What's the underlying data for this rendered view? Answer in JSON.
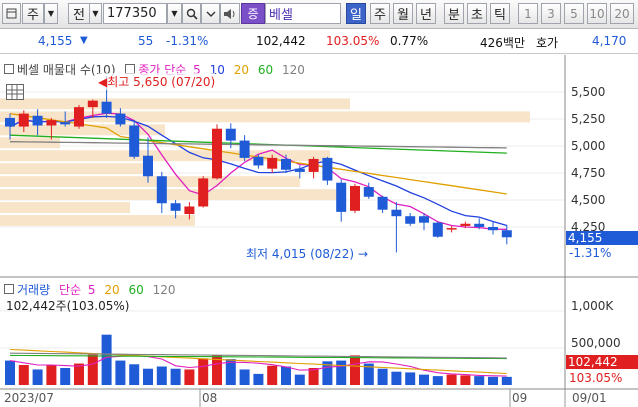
{
  "toolbar": {
    "market": "주",
    "mode": "전",
    "code": "177350",
    "stock_name_prefix": "증",
    "stock_name": "베셀",
    "periods": [
      "일",
      "주",
      "월",
      "년",
      "분",
      "초",
      "틱"
    ],
    "selected_period": "일",
    "intervals": [
      "1",
      "3",
      "5",
      "10",
      "20"
    ]
  },
  "info": {
    "price": "4,155",
    "change": "55",
    "change_pct": "-1.31%",
    "volume": "102,442",
    "volume_ratio": "103.05%",
    "turnover": "0.77%",
    "amount": "426백만",
    "bid_label": "호가",
    "bid_price": "4,170"
  },
  "price_panel": {
    "legend_name": "베셀 매물대 수(10)",
    "ma_label": "종가 단순",
    "ma_periods": [
      "5",
      "10",
      "20",
      "60",
      "120"
    ],
    "high_annotation": "최고 5,650 (07/20)",
    "low_annotation": "최저 4,015 (08/22)",
    "yaxis_ticks": [
      "5,500",
      "5,250",
      "5,000",
      "4,750",
      "4,500",
      "4,250"
    ],
    "current_price_tag": "4,155",
    "current_change_tag": "-1.31%"
  },
  "volume_panel": {
    "legend_name": "거래량",
    "ma_label": "단순",
    "ma_periods": [
      "5",
      "20",
      "60",
      "120"
    ],
    "current_label": "102,442주(103.05%)",
    "yaxis_ticks": [
      "1,000K",
      "500,000"
    ],
    "current_tag": "102,442",
    "current_pct_tag": "103.05%"
  },
  "xaxis": {
    "labels": [
      "2023/07",
      "08",
      "09"
    ],
    "right_date": "09/01"
  },
  "colors": {
    "up": "#e02020",
    "down": "#1f5bd6",
    "ma5": "#e020c0",
    "ma10": "#2040e0",
    "ma20": "#e0a000",
    "ma60": "#20b020",
    "ma120": "#808080",
    "volume_profile": "#f7dfc0"
  },
  "chart_data": {
    "type": "candlestick",
    "candles": [
      {
        "o": 5260,
        "h": 5300,
        "l": 5060,
        "c": 5180
      },
      {
        "o": 5180,
        "h": 5330,
        "l": 5130,
        "c": 5300
      },
      {
        "o": 5280,
        "h": 5340,
        "l": 5100,
        "c": 5190
      },
      {
        "o": 5190,
        "h": 5260,
        "l": 5060,
        "c": 5240
      },
      {
        "o": 5220,
        "h": 5320,
        "l": 5180,
        "c": 5200
      },
      {
        "o": 5180,
        "h": 5380,
        "l": 5160,
        "c": 5360
      },
      {
        "o": 5360,
        "h": 5430,
        "l": 5260,
        "c": 5420
      },
      {
        "o": 5410,
        "h": 5650,
        "l": 5260,
        "c": 5300
      },
      {
        "o": 5300,
        "h": 5350,
        "l": 5180,
        "c": 5200
      },
      {
        "o": 5190,
        "h": 5240,
        "l": 4880,
        "c": 4900
      },
      {
        "o": 4910,
        "h": 5080,
        "l": 4660,
        "c": 4720
      },
      {
        "o": 4720,
        "h": 4760,
        "l": 4380,
        "c": 4470
      },
      {
        "o": 4470,
        "h": 4500,
        "l": 4330,
        "c": 4400
      },
      {
        "o": 4370,
        "h": 4480,
        "l": 4320,
        "c": 4440
      },
      {
        "o": 4440,
        "h": 4720,
        "l": 4430,
        "c": 4700
      },
      {
        "o": 4700,
        "h": 5200,
        "l": 4690,
        "c": 5160
      },
      {
        "o": 5160,
        "h": 5210,
        "l": 4980,
        "c": 5050
      },
      {
        "o": 5050,
        "h": 5100,
        "l": 4860,
        "c": 4890
      },
      {
        "o": 4900,
        "h": 4920,
        "l": 4790,
        "c": 4820
      },
      {
        "o": 4790,
        "h": 4920,
        "l": 4750,
        "c": 4890
      },
      {
        "o": 4880,
        "h": 4920,
        "l": 4750,
        "c": 4780
      },
      {
        "o": 4790,
        "h": 4820,
        "l": 4700,
        "c": 4760
      },
      {
        "o": 4760,
        "h": 4900,
        "l": 4700,
        "c": 4880
      },
      {
        "o": 4890,
        "h": 4900,
        "l": 4640,
        "c": 4680
      },
      {
        "o": 4660,
        "h": 4690,
        "l": 4300,
        "c": 4390
      },
      {
        "o": 4400,
        "h": 4650,
        "l": 4380,
        "c": 4630
      },
      {
        "o": 4620,
        "h": 4660,
        "l": 4510,
        "c": 4530
      },
      {
        "o": 4530,
        "h": 4540,
        "l": 4380,
        "c": 4410
      },
      {
        "o": 4410,
        "h": 4480,
        "l": 4015,
        "c": 4350
      },
      {
        "o": 4350,
        "h": 4380,
        "l": 4260,
        "c": 4280
      },
      {
        "o": 4350,
        "h": 4380,
        "l": 4220,
        "c": 4290
      },
      {
        "o": 4290,
        "h": 4300,
        "l": 4150,
        "c": 4160
      },
      {
        "o": 4230,
        "h": 4260,
        "l": 4200,
        "c": 4240
      },
      {
        "o": 4260,
        "h": 4300,
        "l": 4240,
        "c": 4280
      },
      {
        "o": 4280,
        "h": 4330,
        "l": 4230,
        "c": 4250
      },
      {
        "o": 4250,
        "h": 4300,
        "l": 4180,
        "c": 4220
      },
      {
        "o": 4220,
        "h": 4270,
        "l": 4090,
        "c": 4155
      }
    ],
    "volume": [
      33,
      27,
      21,
      27,
      23,
      29,
      41,
      68,
      33,
      28,
      22,
      25,
      22,
      21,
      36,
      40,
      35,
      21,
      15,
      26,
      25,
      14,
      23,
      32,
      33,
      40,
      29,
      22,
      18,
      17,
      14,
      12,
      14,
      13,
      12,
      11,
      11
    ]
  }
}
